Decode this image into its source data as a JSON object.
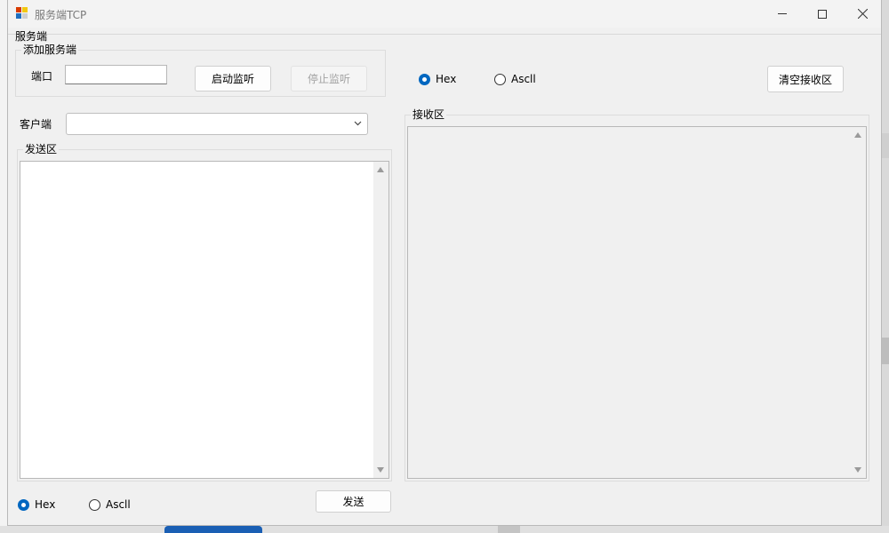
{
  "window": {
    "title": "服务端TCP",
    "menu_label": "服务端"
  },
  "server_group": {
    "title": "添加服务端",
    "port_label": "端口",
    "port_value": "",
    "start_button": "启动监听",
    "stop_button": "停止监听"
  },
  "client": {
    "label": "客户端",
    "selected": ""
  },
  "send_area": {
    "title": "发送区",
    "content": "",
    "format_hex": "Hex",
    "format_ascii": "Ascll",
    "selected_format": "Hex",
    "send_button": "发送"
  },
  "receive_area": {
    "title": "接收区",
    "content": "",
    "format_hex": "Hex",
    "format_ascii": "Ascll",
    "selected_format": "Hex",
    "clear_button": "清空接收区"
  },
  "colors": {
    "accent": "#0067c0",
    "window_bg": "#f0f0f0"
  }
}
